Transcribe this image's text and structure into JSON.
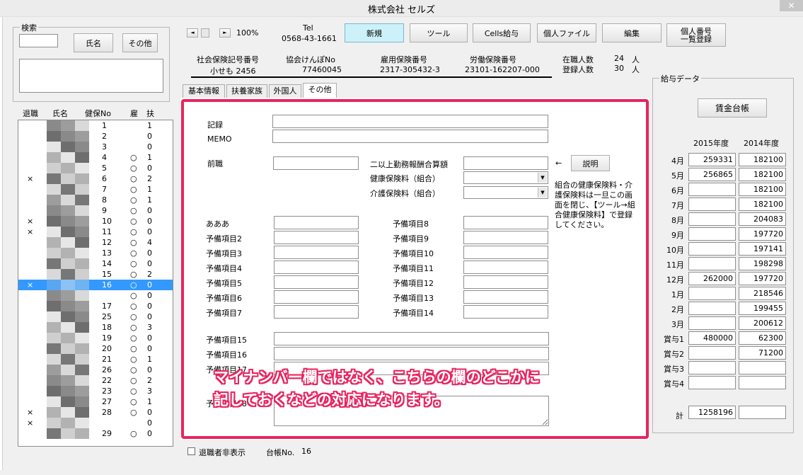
{
  "window": {
    "title": "株式会社 セルズ",
    "close": "✕"
  },
  "search": {
    "legend": "検索",
    "name_button": "氏名",
    "other_button": "その他"
  },
  "list": {
    "headers": {
      "retired": "退職",
      "name": "氏名",
      "no": "健保No",
      "emp": "雇",
      "dep": "扶"
    },
    "rows": [
      {
        "ret": "",
        "no": "1",
        "emp": "",
        "dep": "1"
      },
      {
        "ret": "",
        "no": "2",
        "emp": "",
        "dep": "0"
      },
      {
        "ret": "",
        "no": "3",
        "emp": "",
        "dep": "0"
      },
      {
        "ret": "",
        "no": "4",
        "emp": "○",
        "dep": "1"
      },
      {
        "ret": "",
        "no": "5",
        "emp": "○",
        "dep": "0"
      },
      {
        "ret": "×",
        "no": "6",
        "emp": "○",
        "dep": "2"
      },
      {
        "ret": "",
        "no": "7",
        "emp": "○",
        "dep": "1"
      },
      {
        "ret": "",
        "no": "8",
        "emp": "○",
        "dep": "1"
      },
      {
        "ret": "",
        "no": "9",
        "emp": "○",
        "dep": "0"
      },
      {
        "ret": "×",
        "no": "10",
        "emp": "○",
        "dep": "0"
      },
      {
        "ret": "×",
        "no": "11",
        "emp": "○",
        "dep": "0"
      },
      {
        "ret": "",
        "no": "12",
        "emp": "○",
        "dep": "4"
      },
      {
        "ret": "",
        "no": "13",
        "emp": "○",
        "dep": "0"
      },
      {
        "ret": "",
        "no": "14",
        "emp": "○",
        "dep": "0"
      },
      {
        "ret": "",
        "no": "15",
        "emp": "○",
        "dep": "2"
      },
      {
        "ret": "×",
        "no": "16",
        "emp": "○",
        "dep": "0"
      },
      {
        "ret": "",
        "no": "",
        "emp": "○",
        "dep": "0"
      },
      {
        "ret": "",
        "no": "17",
        "emp": "○",
        "dep": "0"
      },
      {
        "ret": "",
        "no": "25",
        "emp": "○",
        "dep": "0"
      },
      {
        "ret": "",
        "no": "18",
        "emp": "○",
        "dep": "3"
      },
      {
        "ret": "",
        "no": "19",
        "emp": "○",
        "dep": "0"
      },
      {
        "ret": "",
        "no": "20",
        "emp": "○",
        "dep": "0"
      },
      {
        "ret": "",
        "no": "21",
        "emp": "○",
        "dep": "1"
      },
      {
        "ret": "",
        "no": "26",
        "emp": "○",
        "dep": "0"
      },
      {
        "ret": "",
        "no": "22",
        "emp": "○",
        "dep": "2"
      },
      {
        "ret": "",
        "no": "23",
        "emp": "○",
        "dep": "3"
      },
      {
        "ret": "",
        "no": "27",
        "emp": "○",
        "dep": "1"
      },
      {
        "ret": "×",
        "no": "28",
        "emp": "○",
        "dep": "0"
      },
      {
        "ret": "×",
        "no": "",
        "emp": "",
        "dep": "0"
      },
      {
        "ret": "",
        "no": "29",
        "emp": "○",
        "dep": "0"
      }
    ],
    "hide_retired_label": "退職者非表示",
    "ledger_label": "台帳No.",
    "ledger_no": "16"
  },
  "nav": {
    "prev": "◄",
    "next": "►",
    "zoom": "100%"
  },
  "tel": {
    "label": "Tel",
    "number": "0568-43-1661"
  },
  "toolbar": {
    "new": "新規",
    "tool": "ツール",
    "cells": "Cells給与",
    "personal_file": "個人ファイル",
    "edit": "編集",
    "mynumber_line1": "個人番号",
    "mynumber_line2": "一覧登録"
  },
  "info": {
    "social_label": "社会保険記号番号",
    "social_value": "小せも 2456",
    "kyokai_label": "協会けんぽNo",
    "kyokai_value": "77460045",
    "koyo_label": "雇用保険番号",
    "koyo_value": "2317-305432-3",
    "rodo_label": "労働保険番号",
    "rodo_value": "23101-162207-000",
    "current_label": "在職人数",
    "current_value": "24",
    "current_unit": "人",
    "registered_label": "登録人数",
    "registered_value": "30",
    "registered_unit": "人"
  },
  "tabs": [
    "基本情報",
    "扶養家族",
    "外国人",
    "その他"
  ],
  "form": {
    "record": "記録",
    "memo": "MEMO",
    "prev_job": "前職",
    "dual_salary": "二以上勤務報酬合算額",
    "health_ins": "健康保険料（組合）",
    "care_ins": "介護保険料（組合）",
    "arrow": "←",
    "explain_button": "説明",
    "note": [
      "組合の健康保険料・介",
      "護保険料は一旦この画",
      "面を閉じ、【ツール→組",
      "合健康保険料】で登録",
      "してください。"
    ],
    "left_fields": [
      "あああ",
      "予備項目2",
      "予備項目3",
      "予備項目4",
      "予備項目5",
      "予備項目6",
      "予備項目7"
    ],
    "right_fields": [
      "予備項目8",
      "予備項目9",
      "予備項目10",
      "予備項目11",
      "予備項目12",
      "予備項目13",
      "予備項目14"
    ],
    "bottom_fields": [
      "予備項目15",
      "予備項目16",
      "予備項目17",
      "予備項目18"
    ]
  },
  "overlay": {
    "line1": "マイナンバー欄ではなく、こちらの欄のどこかに",
    "line2": "記しておくなどの対応になります。"
  },
  "salary": {
    "legend": "給与データ",
    "ledger_button": "賃金台帳",
    "year1": "2015年度",
    "year2": "2014年度",
    "rows": [
      {
        "label": "4月",
        "y1": "259331",
        "y2": "182100"
      },
      {
        "label": "5月",
        "y1": "256865",
        "y2": "182100"
      },
      {
        "label": "6月",
        "y1": "",
        "y2": "182100"
      },
      {
        "label": "7月",
        "y1": "",
        "y2": "182100"
      },
      {
        "label": "8月",
        "y1": "",
        "y2": "204083"
      },
      {
        "label": "9月",
        "y1": "",
        "y2": "197720"
      },
      {
        "label": "10月",
        "y1": "",
        "y2": "197141"
      },
      {
        "label": "11月",
        "y1": "",
        "y2": "198298"
      },
      {
        "label": "12月",
        "y1": "262000",
        "y2": "197720"
      },
      {
        "label": "1月",
        "y1": "",
        "y2": "218546"
      },
      {
        "label": "2月",
        "y1": "",
        "y2": "199455"
      },
      {
        "label": "3月",
        "y1": "",
        "y2": "200612"
      },
      {
        "label": "賞与1",
        "y1": "480000",
        "y2": "62300"
      },
      {
        "label": "賞与2",
        "y1": "",
        "y2": "71200"
      },
      {
        "label": "賞与3",
        "y1": "",
        "y2": ""
      },
      {
        "label": "賞与4",
        "y1": "",
        "y2": ""
      }
    ],
    "total_label": "計",
    "total_y1": "1258196",
    "total_y2": ""
  }
}
